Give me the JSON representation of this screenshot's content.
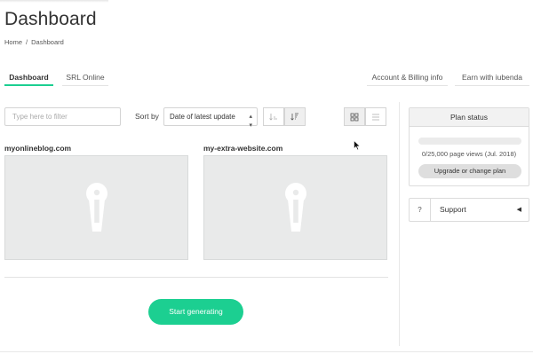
{
  "page": {
    "title": "Dashboard",
    "breadcrumb": {
      "home": "Home",
      "separator": "/",
      "current": "Dashboard"
    }
  },
  "tabs": {
    "dashboard": "Dashboard",
    "srl_online": "SRL Online",
    "account_billing": "Account & Billing info",
    "earn": "Earn with iubenda"
  },
  "toolbar": {
    "filter_placeholder": "Type here to filter",
    "sort_label": "Sort by",
    "sort_selected": "Date of latest update",
    "sort_caret_icon": "up-down-caret-icon",
    "sort_asc_icon": "sort-ascending-icon",
    "sort_desc_icon": "sort-descending-icon",
    "grid_view_icon": "grid-view-icon",
    "list_view_icon": "list-view-icon"
  },
  "sites": [
    {
      "name": "myonlineblog.com",
      "thumbnail_icon": "iubenda-keyhole-logo"
    },
    {
      "name": "my-extra-website.com",
      "thumbnail_icon": "iubenda-keyhole-logo"
    }
  ],
  "cta": {
    "label": "Start generating"
  },
  "sidebar": {
    "plan": {
      "title": "Plan status",
      "usage_fraction": 0,
      "views_text": "0/25,000 page views (Jul. 2018)",
      "button_label": "Upgrade or change plan"
    },
    "support": {
      "icon": "?",
      "label": "Support",
      "arrow_icon": "caret-left-icon"
    }
  },
  "colors": {
    "accent": "#1ccf91",
    "thumb_bg": "#e9eaea",
    "header_bg": "#f2f2f2"
  }
}
